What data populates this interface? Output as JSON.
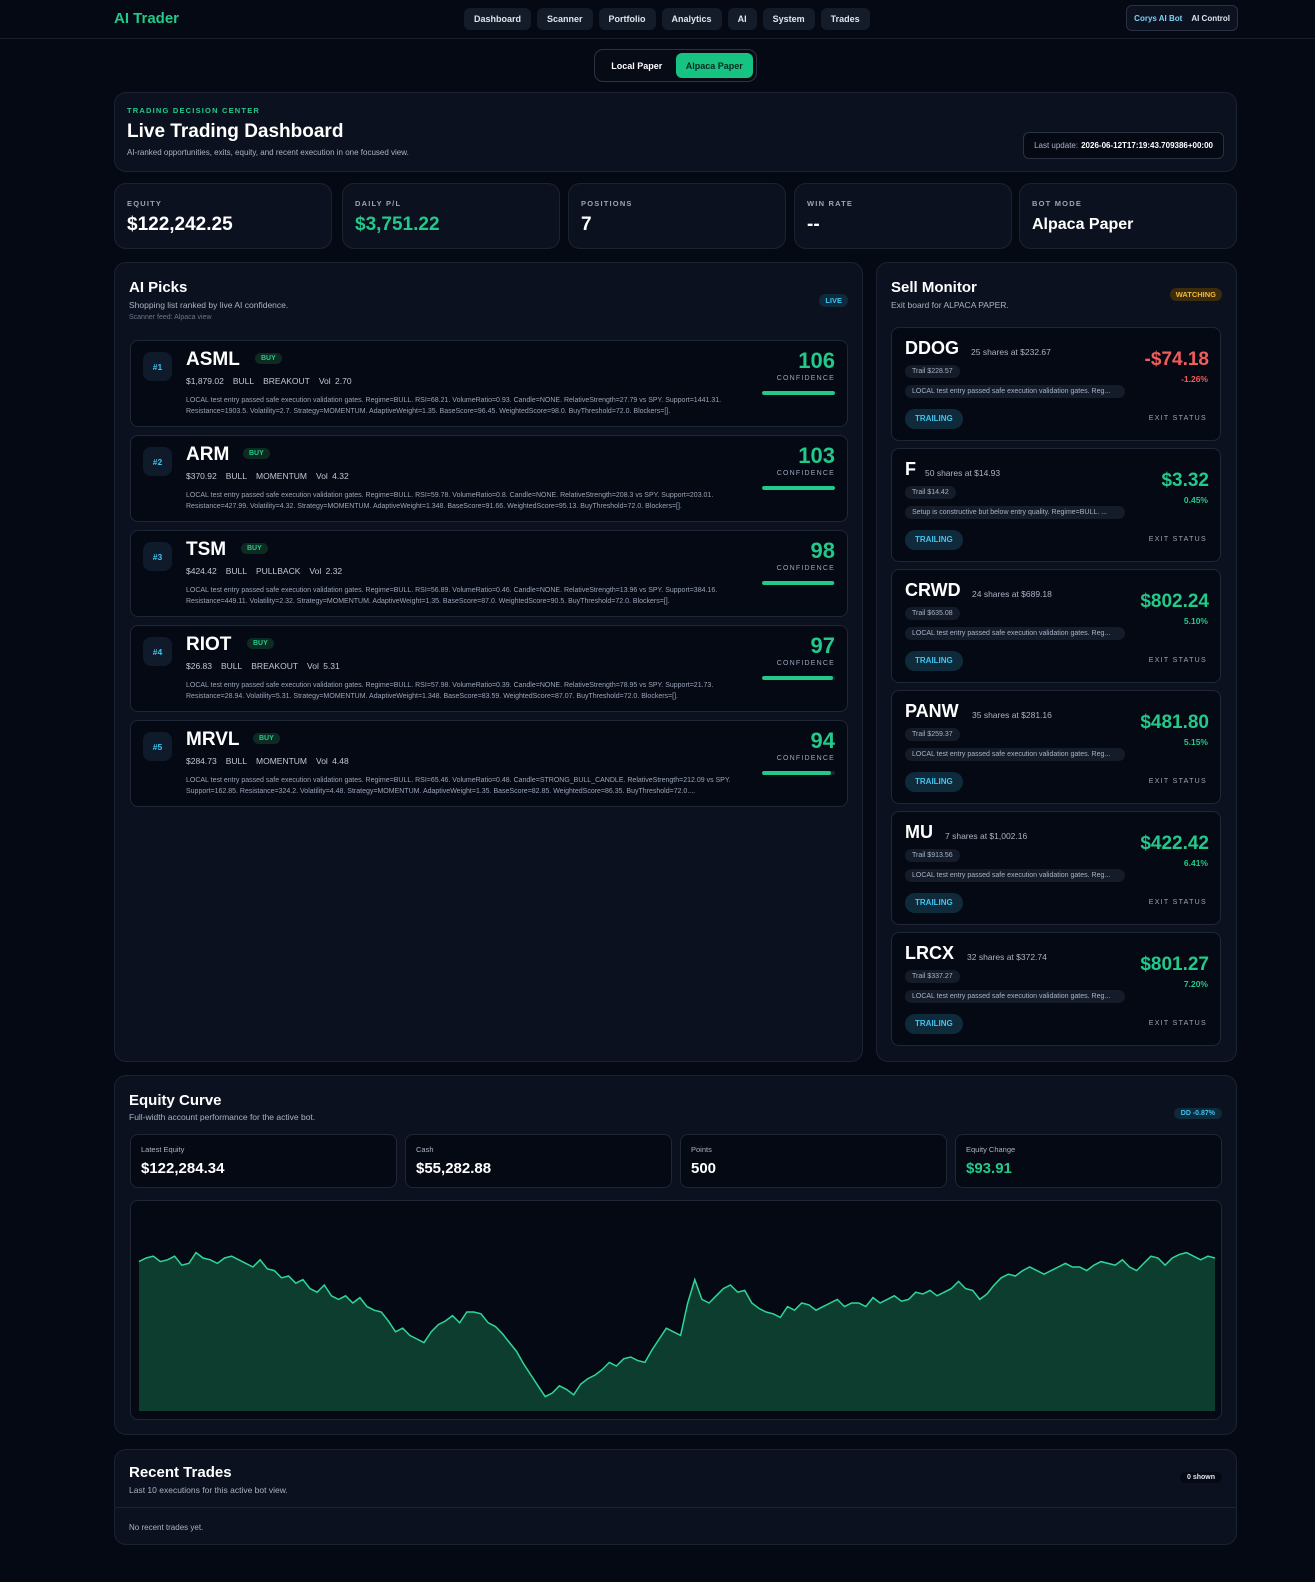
{
  "app": {
    "brand": "AI Trader",
    "nav": [
      "Dashboard",
      "Scanner",
      "Portfolio",
      "Analytics",
      "AI",
      "System",
      "Trades"
    ],
    "user_bot": "Corys AI Bot",
    "user_control": "AI Control"
  },
  "mode_toggle": {
    "options": [
      "Local Paper",
      "Alpaca Paper"
    ],
    "active": "Alpaca Paper"
  },
  "hero": {
    "eyebrow": "TRADING DECISION CENTER",
    "title": "Live Trading Dashboard",
    "subtitle": "AI-ranked opportunities, exits, equity, and recent execution in one focused view.",
    "last_update_label": "Last update:",
    "last_update_value": "2026-06-12T17:19:43.709386+00:00"
  },
  "stats": [
    {
      "label": "EQUITY",
      "value": "$122,242.25"
    },
    {
      "label": "DAILY P/L",
      "value": "$3,751.22"
    },
    {
      "label": "POSITIONS",
      "value": "7"
    },
    {
      "label": "WIN RATE",
      "value": "--"
    },
    {
      "label": "BOT MODE",
      "value": "Alpaca Paper"
    }
  ],
  "picks": {
    "title": "AI Picks",
    "subtitle": "Shopping list ranked by live AI confidence.",
    "feed": "Scanner feed: Alpaca view",
    "badge": "LIVE",
    "confidence_label": "CONFIDENCE",
    "items": [
      {
        "rank": "#1",
        "symbol": "ASML",
        "action": "BUY",
        "price": "$1,879.02",
        "regime": "BULL",
        "setup": "BREAKOUT",
        "vol": "Vol 2.70",
        "score": "106",
        "confidence_fill": 1.0,
        "note": "LOCAL test entry passed safe execution validation gates. Regime=BULL. RSI=68.21. VolumeRatio=0.93. Candle=NONE. RelativeStrength=27.79 vs SPY. Support=1441.31. Resistance=1903.5. Volatility=2.7. Strategy=MOMENTUM. AdaptiveWeight=1.35. BaseScore=96.45. WeightedScore=98.0. BuyThreshold=72.0. Blockers=[]."
      },
      {
        "rank": "#2",
        "symbol": "ARM",
        "action": "BUY",
        "price": "$370.92",
        "regime": "BULL",
        "setup": "MOMENTUM",
        "vol": "Vol 4.32",
        "score": "103",
        "confidence_fill": 1.0,
        "note": "LOCAL test entry passed safe execution validation gates. Regime=BULL. RSI=59.78. VolumeRatio=0.8. Candle=NONE. RelativeStrength=208.3 vs SPY. Support=203.01. Resistance=427.99. Volatility=4.32. Strategy=MOMENTUM. AdaptiveWeight=1.348. BaseScore=91.66. WeightedScore=95.13. BuyThreshold=72.0. Blockers=[]."
      },
      {
        "rank": "#3",
        "symbol": "TSM",
        "action": "BUY",
        "price": "$424.42",
        "regime": "BULL",
        "setup": "PULLBACK",
        "vol": "Vol 2.32",
        "score": "98",
        "confidence_fill": 0.98,
        "note": "LOCAL test entry passed safe execution validation gates. Regime=BULL. RSI=56.89. VolumeRatio=0.46. Candle=NONE. RelativeStrength=13.96 vs SPY. Support=384.16. Resistance=449.11. Volatility=2.32. Strategy=MOMENTUM. AdaptiveWeight=1.35. BaseScore=87.0. WeightedScore=90.5. BuyThreshold=72.0. Blockers=[]."
      },
      {
        "rank": "#4",
        "symbol": "RIOT",
        "action": "BUY",
        "price": "$26.83",
        "regime": "BULL",
        "setup": "BREAKOUT",
        "vol": "Vol 5.31",
        "score": "97",
        "confidence_fill": 0.97,
        "note": "LOCAL test entry passed safe execution validation gates. Regime=BULL. RSI=57.98. VolumeRatio=0.39. Candle=NONE. RelativeStrength=78.95 vs SPY. Support=21.73. Resistance=28.94. Volatility=5.31. Strategy=MOMENTUM. AdaptiveWeight=1.348. BaseScore=83.59. WeightedScore=87.07. BuyThreshold=72.0. Blockers=[]."
      },
      {
        "rank": "#5",
        "symbol": "MRVL",
        "action": "BUY",
        "price": "$284.73",
        "regime": "BULL",
        "setup": "MOMENTUM",
        "vol": "Vol 4.48",
        "score": "94",
        "confidence_fill": 0.94,
        "note": "LOCAL test entry passed safe execution validation gates. Regime=BULL. RSI=65.46. VolumeRatio=0.48. Candle=STRONG_BULL_CANDLE. RelativeStrength=212.09 vs SPY. Support=162.85. Resistance=324.2. Volatility=4.48. Strategy=MOMENTUM. AdaptiveWeight=1.35. BaseScore=82.85. WeightedScore=86.35. BuyThreshold=72.0...."
      }
    ]
  },
  "sell_monitor": {
    "title": "Sell Monitor",
    "subtitle": "Exit board for ALPACA PAPER.",
    "badge": "WATCHING",
    "status_label": "TRAILING",
    "exit_label": "EXIT STATUS",
    "positions": [
      {
        "symbol": "DDOG",
        "shares": "25 shares at $232.67",
        "trail": "Trail $228.57",
        "reason": "LOCAL test entry passed safe execution validation gates. Reg...",
        "pnl": "-$74.18",
        "pct": "-1.26%",
        "negative": true
      },
      {
        "symbol": "F",
        "shares": "50 shares at $14.93",
        "trail": "Trail $14.42",
        "reason": "Setup is constructive but below entry quality. Regime=BULL. ...",
        "pnl": "$3.32",
        "pct": "0.45%",
        "negative": false
      },
      {
        "symbol": "CRWD",
        "shares": "24 shares at $689.18",
        "trail": "Trail $635.08",
        "reason": "LOCAL test entry passed safe execution validation gates. Reg...",
        "pnl": "$802.24",
        "pct": "5.10%",
        "negative": false
      },
      {
        "symbol": "PANW",
        "shares": "35 shares at $281.16",
        "trail": "Trail $259.37",
        "reason": "LOCAL test entry passed safe execution validation gates. Reg...",
        "pnl": "$481.80",
        "pct": "5.15%",
        "negative": false
      },
      {
        "symbol": "MU",
        "shares": "7 shares at $1,002.16",
        "trail": "Trail $913.56",
        "reason": "LOCAL test entry passed safe execution validation gates. Reg...",
        "pnl": "$422.42",
        "pct": "6.41%",
        "negative": false
      },
      {
        "symbol": "LRCX",
        "shares": "32 shares at $372.74",
        "trail": "Trail $337.27",
        "reason": "LOCAL test entry passed safe execution validation gates. Reg...",
        "pnl": "$801.27",
        "pct": "7.20%",
        "negative": false
      }
    ]
  },
  "equity_curve": {
    "title": "Equity Curve",
    "subtitle": "Full-width account performance for the active bot.",
    "badge": "DD -0.87%",
    "metrics": [
      {
        "label": "Latest Equity",
        "value": "$122,284.34"
      },
      {
        "label": "Cash",
        "value": "$55,282.88"
      },
      {
        "label": "Points",
        "value": "500"
      },
      {
        "label": "Equity Change",
        "value": "$93.91"
      }
    ]
  },
  "chart_data": {
    "type": "area",
    "title": "",
    "xlabel": "",
    "ylabel": "",
    "grid": false,
    "legend": "none",
    "line_color": "#2ed69a",
    "fill_color": "#0d3d2e",
    "series": [
      {
        "values": [
          0.83,
          0.85,
          0.86,
          0.83,
          0.84,
          0.86,
          0.81,
          0.82,
          0.88,
          0.85,
          0.84,
          0.82,
          0.85,
          0.86,
          0.84,
          0.82,
          0.8,
          0.84,
          0.79,
          0.78,
          0.74,
          0.75,
          0.71,
          0.73,
          0.68,
          0.66,
          0.7,
          0.64,
          0.62,
          0.64,
          0.6,
          0.63,
          0.58,
          0.56,
          0.55,
          0.5,
          0.44,
          0.46,
          0.42,
          0.4,
          0.38,
          0.44,
          0.48,
          0.5,
          0.53,
          0.49,
          0.55,
          0.55,
          0.54,
          0.49,
          0.47,
          0.43,
          0.38,
          0.33,
          0.26,
          0.2,
          0.14,
          0.08,
          0.1,
          0.14,
          0.12,
          0.09,
          0.15,
          0.18,
          0.2,
          0.23,
          0.27,
          0.25,
          0.29,
          0.3,
          0.28,
          0.27,
          0.34,
          0.4,
          0.46,
          0.44,
          0.42,
          0.6,
          0.73,
          0.62,
          0.6,
          0.64,
          0.68,
          0.7,
          0.66,
          0.67,
          0.6,
          0.57,
          0.55,
          0.54,
          0.52,
          0.58,
          0.56,
          0.6,
          0.59,
          0.56,
          0.58,
          0.6,
          0.62,
          0.58,
          0.6,
          0.6,
          0.58,
          0.63,
          0.6,
          0.62,
          0.64,
          0.61,
          0.62,
          0.66,
          0.65,
          0.67,
          0.64,
          0.66,
          0.68,
          0.72,
          0.68,
          0.67,
          0.62,
          0.65,
          0.7,
          0.74,
          0.76,
          0.75,
          0.78,
          0.8,
          0.78,
          0.76,
          0.78,
          0.8,
          0.82,
          0.8,
          0.8,
          0.78,
          0.81,
          0.83,
          0.82,
          0.81,
          0.84,
          0.8,
          0.78,
          0.82,
          0.86,
          0.85,
          0.81,
          0.85,
          0.87,
          0.88,
          0.86,
          0.84,
          0.86,
          0.85
        ]
      }
    ]
  },
  "recent_trades": {
    "title": "Recent Trades",
    "subtitle": "Last 10 executions for this active bot view.",
    "badge": "0 shown",
    "empty": "No recent trades yet."
  }
}
